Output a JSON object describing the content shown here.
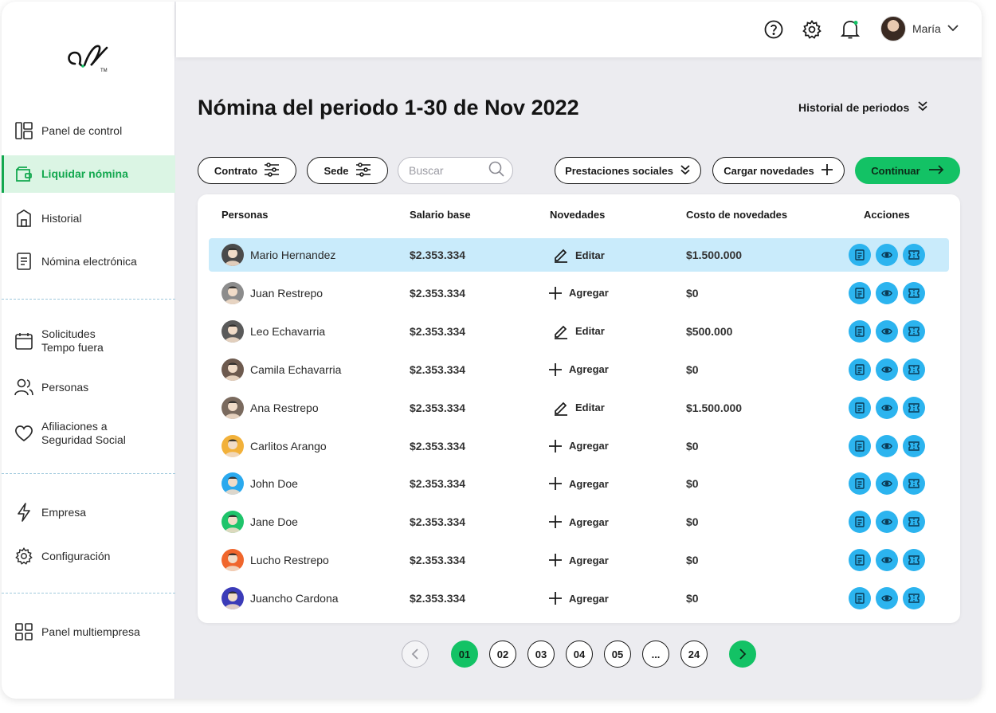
{
  "sidebar": {
    "brand": "al",
    "items": [
      {
        "label": "Panel de control",
        "icon": "dashboard-icon"
      },
      {
        "label": "Liquidar nómina",
        "icon": "wallet-icon",
        "active": true
      },
      {
        "label": "Historial",
        "icon": "history-icon"
      },
      {
        "label": "Nómina electrónica",
        "icon": "document-icon"
      },
      {
        "label": "Solicitudes Tempo fuera",
        "icon": "calendar-icon"
      },
      {
        "label": "Personas",
        "icon": "people-icon"
      },
      {
        "label": "Afiliaciones a Seguridad Social",
        "icon": "heart-icon"
      },
      {
        "label": "Empresa",
        "icon": "lightning-icon"
      },
      {
        "label": "Configuración",
        "icon": "gear-icon"
      },
      {
        "label": "Panel multiempresa",
        "icon": "grid-icon"
      }
    ],
    "item_lines": {
      "solicitudes": [
        "Solicitudes",
        "Tempo fuera"
      ],
      "afiliaciones": [
        "Afiliaciones a",
        "Seguridad Social"
      ]
    }
  },
  "topbar": {
    "user_name": "María"
  },
  "page": {
    "title": "Nómina del periodo 1-30 de Nov 2022",
    "history_label": "Historial de periodos"
  },
  "toolbar": {
    "contrato_label": "Contrato",
    "sede_label": "Sede",
    "search_placeholder": "Buscar",
    "prestaciones_label": "Prestaciones sociales",
    "cargar_label": "Cargar novedades",
    "continue_label": "Continuar"
  },
  "table": {
    "headers": [
      "Personas",
      "Salario base",
      "Novedades",
      "Costo de novedades",
      "Acciones"
    ],
    "rows": [
      {
        "name": "Mario Hernandez",
        "salary": "$2.353.334",
        "novedad": "Editar",
        "cost": "$1.500.000",
        "avatar_color": "#4a4a4a"
      },
      {
        "name": "Juan Restrepo",
        "salary": "$2.353.334",
        "novedad": "Agregar",
        "cost": "$0",
        "avatar_color": "#8c8c8c"
      },
      {
        "name": "Leo Echavarria",
        "salary": "$2.353.334",
        "novedad": "Editar",
        "cost": "$500.000",
        "avatar_color": "#5a5a5a"
      },
      {
        "name": "Camila Echavarria",
        "salary": "$2.353.334",
        "novedad": "Agregar",
        "cost": "$0",
        "avatar_color": "#6d5a4e"
      },
      {
        "name": "Ana Restrepo",
        "salary": "$2.353.334",
        "novedad": "Editar",
        "cost": "$1.500.000",
        "avatar_color": "#7a6a5e"
      },
      {
        "name": "Carlitos Arango",
        "salary": "$2.353.334",
        "novedad": "Agregar",
        "cost": "$0",
        "avatar_color": "#f2b13a"
      },
      {
        "name": "John Doe",
        "salary": "$2.353.334",
        "novedad": "Agregar",
        "cost": "$0",
        "avatar_color": "#2aa9ee"
      },
      {
        "name": "Jane Doe",
        "salary": "$2.353.334",
        "novedad": "Agregar",
        "cost": "$0",
        "avatar_color": "#1fc46b"
      },
      {
        "name": "Lucho Restrepo",
        "salary": "$2.353.334",
        "novedad": "Agregar",
        "cost": "$0",
        "avatar_color": "#f0662c"
      },
      {
        "name": "Juancho Cardona",
        "salary": "$2.353.334",
        "novedad": "Agregar",
        "cost": "$0",
        "avatar_color": "#3b3bb8"
      }
    ]
  },
  "pagination": {
    "pages": [
      "01",
      "02",
      "03",
      "04",
      "05",
      "...",
      "24"
    ],
    "current": "01"
  },
  "colors": {
    "accent_green": "#13c265",
    "action_blue": "#2cb4ef",
    "selected_row": "#c9ebfb",
    "active_nav_bg": "#dbf5e4"
  }
}
